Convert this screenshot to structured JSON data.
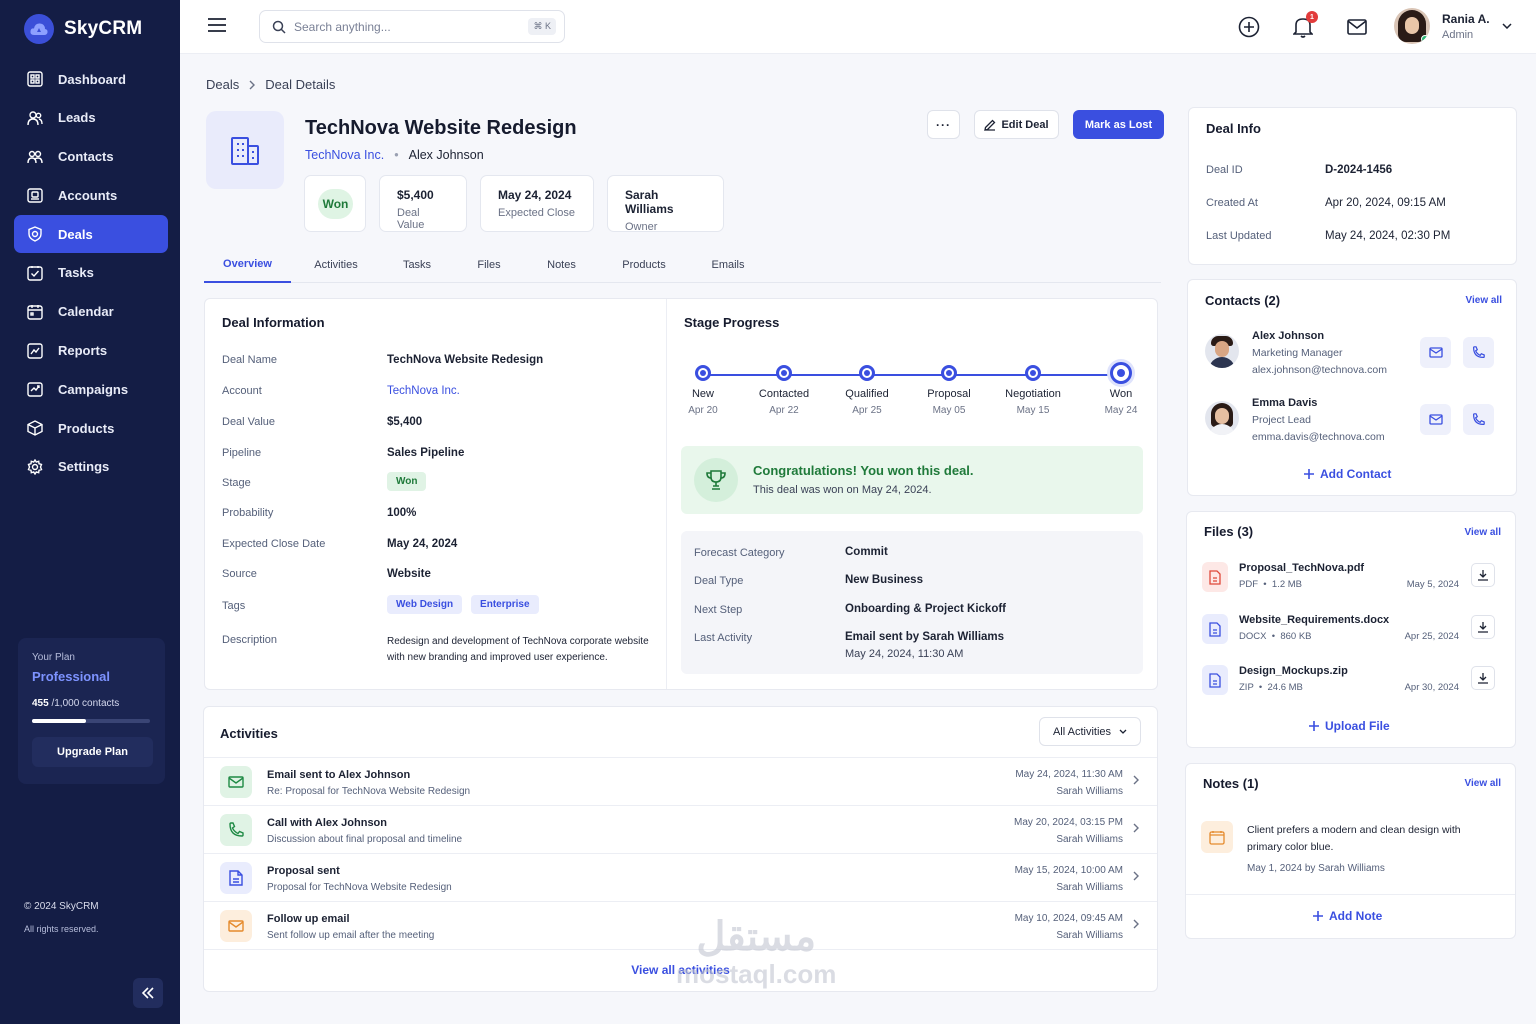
{
  "app": {
    "name": "SkyCRM"
  },
  "sidebar": {
    "items": [
      {
        "label": "Dashboard",
        "icon": "dashboard-icon"
      },
      {
        "label": "Leads",
        "icon": "leads-icon"
      },
      {
        "label": "Contacts",
        "icon": "contacts-icon"
      },
      {
        "label": "Accounts",
        "icon": "accounts-icon"
      },
      {
        "label": "Deals",
        "icon": "deals-icon",
        "active": true
      },
      {
        "label": "Tasks",
        "icon": "tasks-icon"
      },
      {
        "label": "Calendar",
        "icon": "calendar-icon"
      },
      {
        "label": "Reports",
        "icon": "reports-icon"
      },
      {
        "label": "Campaigns",
        "icon": "campaigns-icon"
      },
      {
        "label": "Products",
        "icon": "products-icon"
      },
      {
        "label": "Settings",
        "icon": "settings-icon"
      }
    ],
    "plan": {
      "label": "Your Plan",
      "name": "Professional",
      "used": "455",
      "limit": "/1,000 contacts",
      "usage_fraction": 0.455,
      "upgrade": "Upgrade Plan"
    },
    "copyright": "© 2024 SkyCRM",
    "rights": "All rights reserved."
  },
  "topbar": {
    "search_placeholder": "Search anything...",
    "shortcut": "⌘ K",
    "notifications_count": "1",
    "user": {
      "name": "Rania A.",
      "role": "Admin"
    }
  },
  "breadcrumb": {
    "parent": "Deals",
    "current": "Deal Details"
  },
  "deal": {
    "title": "TechNova Website Redesign",
    "account": "TechNova Inc.",
    "contact": "Alex Johnson",
    "status": "Won",
    "kpis": [
      {
        "value": "$5,400",
        "label": "Deal Value"
      },
      {
        "value": "May 24, 2024",
        "label": "Expected Close"
      },
      {
        "value": "Sarah Williams",
        "label": "Owner"
      }
    ],
    "actions": {
      "more": "···",
      "edit": "Edit Deal",
      "lost": "Mark as Lost"
    }
  },
  "tabs": [
    "Overview",
    "Activities",
    "Tasks",
    "Files",
    "Notes",
    "Products",
    "Emails"
  ],
  "deal_information": {
    "title": "Deal Information",
    "rows": [
      {
        "label": "Deal Name",
        "value": "TechNova Website Redesign"
      },
      {
        "label": "Account",
        "value": "TechNova Inc."
      },
      {
        "label": "Deal Value",
        "value": "$5,400"
      },
      {
        "label": "Pipeline",
        "value": "Sales Pipeline"
      },
      {
        "label": "Stage",
        "value": "Won"
      },
      {
        "label": "Probability",
        "value": "100%"
      },
      {
        "label": "Expected Close Date",
        "value": "May 24, 2024"
      },
      {
        "label": "Source",
        "value": "Website"
      },
      {
        "label": "Tags",
        "values": [
          "Web Design",
          "Enterprise"
        ]
      },
      {
        "label": "Description",
        "value": "Redesign and development of TechNova corporate website with new branding and improved user experience."
      }
    ]
  },
  "stage_progress": {
    "title": "Stage Progress",
    "stages": [
      {
        "name": "New",
        "date": "Apr 20"
      },
      {
        "name": "Contacted",
        "date": "Apr 22"
      },
      {
        "name": "Qualified",
        "date": "Apr 25"
      },
      {
        "name": "Proposal",
        "date": "May 05"
      },
      {
        "name": "Negotiation",
        "date": "May 15"
      },
      {
        "name": "Won",
        "date": "May 24"
      }
    ],
    "congrats_title": "Congratulations! You won this deal.",
    "congrats_text": "This deal was won on May 24, 2024.",
    "forecast": [
      {
        "label": "Forecast Category",
        "value": "Commit"
      },
      {
        "label": "Deal Type",
        "value": "New Business"
      },
      {
        "label": "Next Step",
        "value": "Onboarding & Project Kickoff"
      },
      {
        "label": "Last Activity",
        "value": "Email sent by Sarah Williams",
        "sub": "May 24, 2024, 11:30 AM"
      }
    ]
  },
  "activities": {
    "title": "Activities",
    "filter": "All Activities",
    "items": [
      {
        "title": "Email sent to Alex Johnson",
        "sub": "Re: Proposal for TechNova Website Redesign",
        "date": "May 24, 2024, 11:30 AM",
        "user": "Sarah Williams",
        "icon": "mail-icon"
      },
      {
        "title": "Call with Alex Johnson",
        "sub": "Discussion about final proposal and timeline",
        "date": "May 20, 2024, 03:15 PM",
        "user": "Sarah Williams",
        "icon": "phone-icon"
      },
      {
        "title": "Proposal sent",
        "sub": "Proposal for TechNova Website Redesign",
        "date": "May 15, 2024, 10:00 AM",
        "user": "Sarah Williams",
        "icon": "document-icon"
      },
      {
        "title": "Follow up email",
        "sub": "Sent follow up email after the meeting",
        "date": "May 10, 2024, 09:45 AM",
        "user": "Sarah Williams",
        "icon": "envelope-icon"
      }
    ],
    "view_all": "View all activities"
  },
  "deal_info": {
    "title": "Deal Info",
    "rows": [
      {
        "label": "Deal ID",
        "value": "D-2024-1456"
      },
      {
        "label": "Created At",
        "value": "Apr 20, 2024, 09:15 AM"
      },
      {
        "label": "Last Updated",
        "value": "May 24, 2024, 02:30 PM"
      }
    ]
  },
  "contacts": {
    "title": "Contacts (2)",
    "view_all": "View all",
    "items": [
      {
        "name": "Alex Johnson",
        "role": "Marketing Manager",
        "email": "alex.johnson@technova.com"
      },
      {
        "name": "Emma Davis",
        "role": "Project Lead",
        "email": "emma.davis@technova.com"
      }
    ],
    "add": "Add Contact"
  },
  "files": {
    "title": "Files (3)",
    "view_all": "View all",
    "items": [
      {
        "name": "Proposal_TechNova.pdf",
        "type": "PDF",
        "size": "1.2 MB",
        "date": "May 5, 2024"
      },
      {
        "name": "Website_Requirements.docx",
        "type": "DOCX",
        "size": "860 KB",
        "date": "Apr 25, 2024"
      },
      {
        "name": "Design_Mockups.zip",
        "type": "ZIP",
        "size": "24.6 MB",
        "date": "Apr 30, 2024"
      }
    ],
    "upload": "Upload File"
  },
  "notes": {
    "title": "Notes (1)",
    "view_all": "View all",
    "items": [
      {
        "text": "Client prefers a modern and clean design with primary color blue.",
        "meta": "May 1, 2024 by Sarah Williams"
      }
    ],
    "add": "Add Note"
  },
  "watermark": {
    "arabic": "مستقل",
    "latin": "mostaql.com"
  }
}
